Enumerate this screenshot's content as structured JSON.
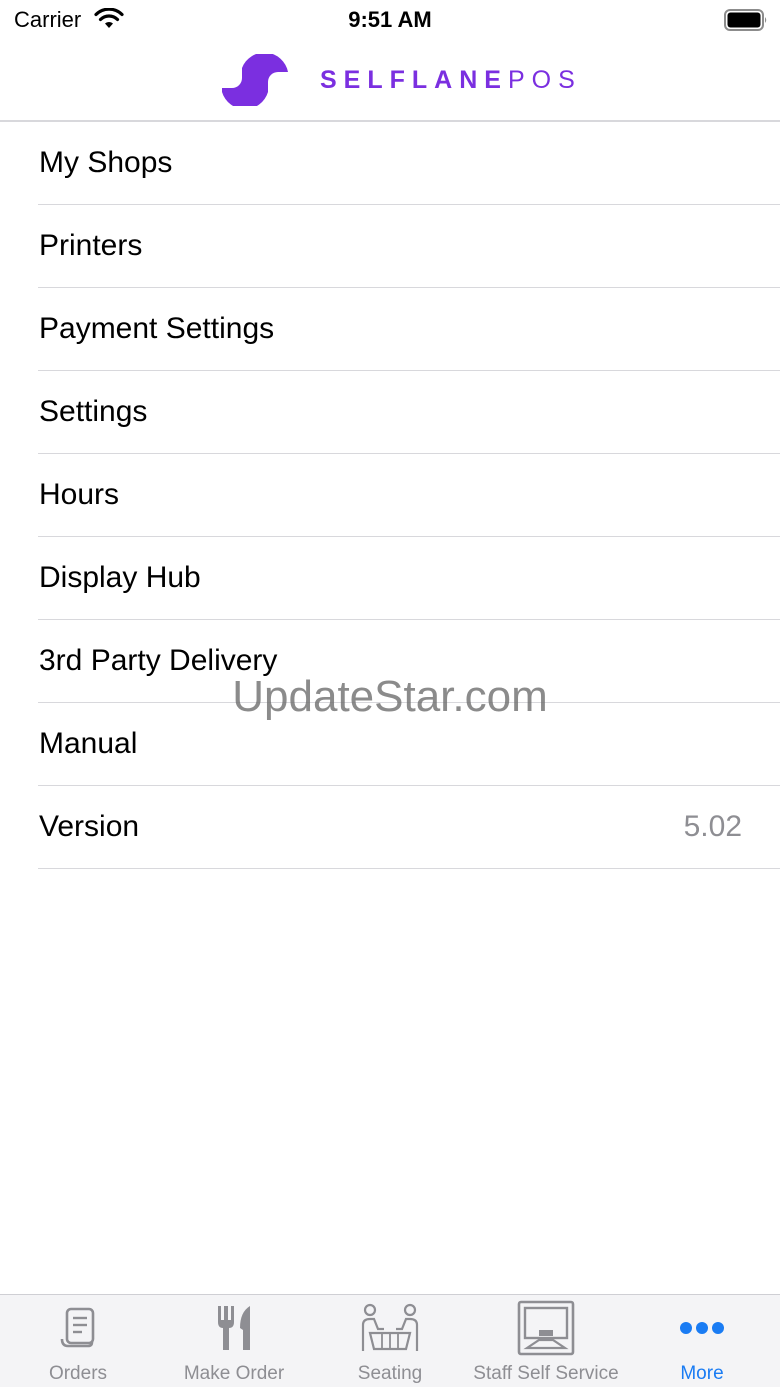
{
  "status_bar": {
    "carrier": "Carrier",
    "time": "9:51 AM"
  },
  "header": {
    "brand_bold": "SELFLANE",
    "brand_light": "POS",
    "brand_color": "#7b2fe0"
  },
  "menu": {
    "items": [
      {
        "label": "My Shops"
      },
      {
        "label": "Printers"
      },
      {
        "label": "Payment Settings"
      },
      {
        "label": "Settings"
      },
      {
        "label": "Hours"
      },
      {
        "label": "Display Hub"
      },
      {
        "label": "3rd Party Delivery"
      },
      {
        "label": "Manual"
      },
      {
        "label": "Version",
        "value": "5.02"
      }
    ]
  },
  "watermark": "UpdateStar.com",
  "tabbar": {
    "active_color": "#1a7cf3",
    "inactive_color": "#8e8e93",
    "tabs": [
      {
        "label": "Orders",
        "icon": "receipt-icon"
      },
      {
        "label": "Make Order",
        "icon": "fork-knife-icon"
      },
      {
        "label": "Seating",
        "icon": "dining-table-icon"
      },
      {
        "label": "Staff Self Service",
        "icon": "kiosk-icon"
      },
      {
        "label": "More",
        "icon": "more-dots-icon",
        "active": true
      }
    ]
  }
}
